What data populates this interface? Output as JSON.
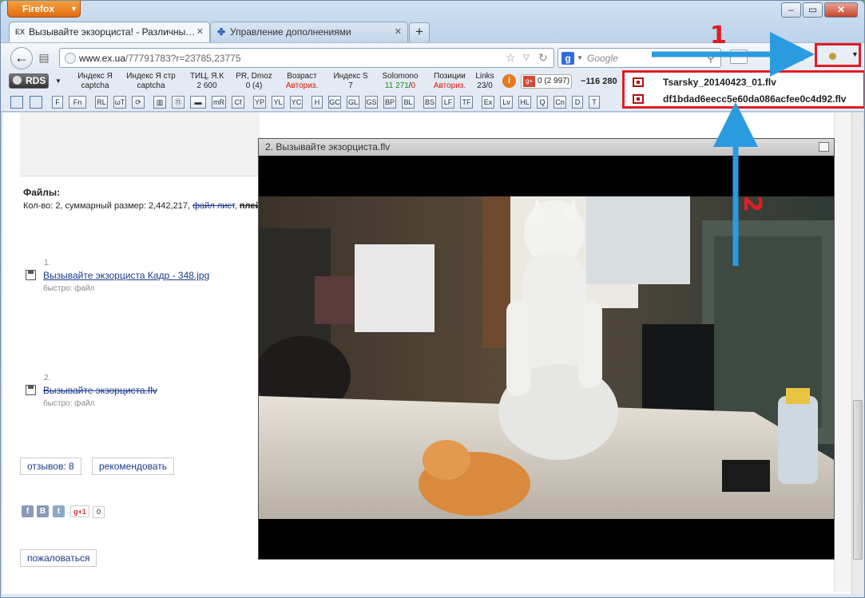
{
  "browser": {
    "menu_button": "Firefox",
    "tabs": [
      {
        "label": "Вызывайте экзорциста! - Различны…",
        "favicon": "EX"
      },
      {
        "label": "Управление дополнениями",
        "favicon": "puzzle-icon"
      }
    ],
    "url_domain": "www.ex.ua",
    "url_path": "/77791783?r=23785,23775",
    "search_placeholder": "Google"
  },
  "toolbar": {
    "rds_label": "RDS",
    "metrics": [
      {
        "label": "Индекс Я",
        "value": "captcha"
      },
      {
        "label": "Индекс Я стр",
        "value": "captcha"
      },
      {
        "label": "ТИЦ, Я.К",
        "value": "2 600"
      },
      {
        "label": "PR, Dmoz",
        "value": "0 (4)"
      },
      {
        "label": "Возраст",
        "value": "Авториз."
      },
      {
        "label": "Индекс S",
        "value": "7"
      },
      {
        "label": "Solomono",
        "value_green": "11 271",
        "value_red": "0"
      },
      {
        "label": "Позиции",
        "value": "Авториз."
      },
      {
        "label": "Links",
        "value": "23/0"
      }
    ],
    "gplus_count": "0 (2 997)",
    "alexa": "~116 280",
    "short_buttons": [
      "F",
      "Fn",
      "RL",
      "ωT",
      "⟳",
      "▥",
      "⑪",
      "▬",
      "mR",
      "Cf",
      "YP",
      "YL",
      "YC",
      "H",
      "GC",
      "GL",
      "GS",
      "BP",
      "BL",
      "BS",
      "LF",
      "TF",
      "Ex",
      "Lv",
      "HL",
      "Q",
      "Cn",
      "D",
      "T"
    ]
  },
  "page": {
    "files_heading": "Файлы:",
    "files_summary_prefix": "Кол-во: 2, суммарный размер: 2,442,217, ",
    "files_list_link": "файл лист",
    "files_playlist_link": "плей",
    "file_items": [
      {
        "num": "1.",
        "name": "Вызывайте экзорциста Кадр - 348.jpg",
        "sub": "быстро: файл"
      },
      {
        "num": "2.",
        "name": "Вызывайте экзорциста.flv",
        "sub": "быстро: файл"
      }
    ],
    "reviews_button": "отзывов: 8",
    "recommend_button": "рекомендовать",
    "gplus_count": "0",
    "complain_button": "пожаловаться"
  },
  "video": {
    "title": "2. Вызывайте экзорциста.flv"
  },
  "download_dropdown": {
    "items": [
      "Tsarsky_20140423_01.flv",
      "df1bdad6eecc5e60da086acfee0c4d92.flv"
    ]
  },
  "annotations": {
    "one": "1",
    "two": "2"
  }
}
